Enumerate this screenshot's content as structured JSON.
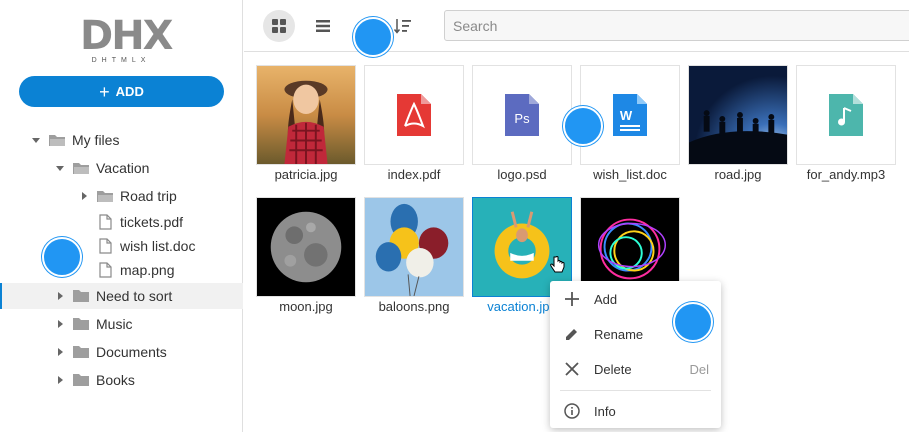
{
  "logo": {
    "text": "DHX",
    "subtext": "DHTMLX"
  },
  "sidebar": {
    "add_label": "ADD",
    "tree": [
      {
        "label": "My files",
        "type": "folder-open",
        "expanded": true
      },
      {
        "label": "Vacation",
        "type": "folder-open",
        "expanded": true
      },
      {
        "label": "Road trip",
        "type": "folder",
        "expanded": false
      },
      {
        "label": "tickets.pdf",
        "type": "file"
      },
      {
        "label": "wish list.doc",
        "type": "file"
      },
      {
        "label": "map.png",
        "type": "file"
      },
      {
        "label": "Need to sort",
        "type": "folder",
        "expanded": false,
        "selected": true
      },
      {
        "label": "Music",
        "type": "folder",
        "expanded": false
      },
      {
        "label": "Documents",
        "type": "folder",
        "expanded": false
      },
      {
        "label": "Books",
        "type": "folder",
        "expanded": false
      }
    ]
  },
  "toolbar": {
    "grid_view_icon": "grid-view-icon",
    "list_view_icon": "list-view-icon",
    "sort_icon": "sort-icon",
    "search_placeholder": "Search"
  },
  "files": [
    {
      "name": "patricia.jpg",
      "kind": "photo"
    },
    {
      "name": "index.pdf",
      "kind": "pdf",
      "color": "#e53935"
    },
    {
      "name": "logo.psd",
      "kind": "psd",
      "color": "#5c6bc0"
    },
    {
      "name": "wish_list.doc",
      "kind": "doc",
      "color": "#1e88e5"
    },
    {
      "name": "road.jpg",
      "kind": "photo"
    },
    {
      "name": "for_andy.mp3",
      "kind": "audio",
      "color": "#4db6ac"
    },
    {
      "name": "moon.jpg",
      "kind": "photo"
    },
    {
      "name": "baloons.png",
      "kind": "photo"
    },
    {
      "name": "vacation.jpg",
      "kind": "photo",
      "selected": true
    },
    {
      "name": "",
      "kind": "photo"
    }
  ],
  "context_menu": {
    "items": [
      {
        "label": "Add",
        "icon": "plus-icon",
        "hotkey": ""
      },
      {
        "label": "Rename",
        "icon": "pencil-icon",
        "hotkey": ""
      },
      {
        "label": "Delete",
        "icon": "close-icon",
        "hotkey": "Del"
      },
      {
        "label": "Info",
        "icon": "info-icon",
        "hotkey": ""
      }
    ]
  },
  "colors": {
    "accent": "#0b82d4",
    "marker": "#2196f3"
  }
}
